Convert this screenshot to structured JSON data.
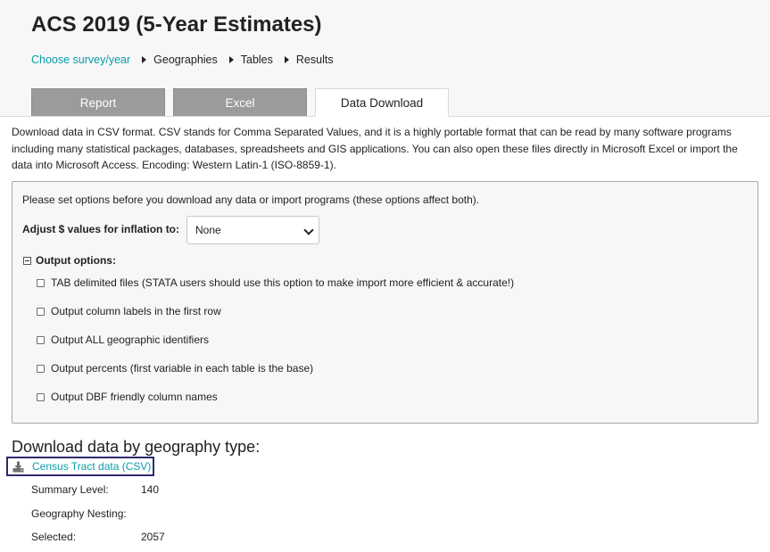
{
  "header": {
    "title": "ACS 2019 (5-Year Estimates)",
    "breadcrumbs": [
      "Choose survey/year",
      "Geographies",
      "Tables",
      "Results"
    ]
  },
  "tabs": [
    {
      "label": "Report",
      "active": false
    },
    {
      "label": "Excel",
      "active": false
    },
    {
      "label": "Data Download",
      "active": true
    }
  ],
  "intro_text": "Download data in CSV format. CSV stands for Comma Separated Values, and it is a highly portable format that can be read by many software programs including many statistical packages, databases, spreadsheets and GIS applications. You can also open these files directly in Microsoft Excel or import the data into Microsoft Access. Encoding: Western Latin-1 (ISO-8859-1).",
  "options": {
    "note": "Please set options before you download any data or import programs (these options affect both).",
    "inflation_label": "Adjust $ values for inflation to:",
    "inflation_value": "None",
    "output_options_label": "Output options:",
    "checkboxes": [
      {
        "label": "TAB delimited files (STATA users should use this option to make import more efficient & accurate!)",
        "checked": false
      },
      {
        "label": "Output column labels in the first row",
        "checked": false
      },
      {
        "label": "Output ALL geographic identifiers",
        "checked": false
      },
      {
        "label": "Output percents (first variable in each table is the base)",
        "checked": false
      },
      {
        "label": "Output DBF friendly column names",
        "checked": false
      }
    ]
  },
  "geography": {
    "heading": "Download data by geography type:",
    "link_label": "Census Tract data (CSV)",
    "icon": "download-icon",
    "summary_level_label": "Summary Level:",
    "summary_level_value": "140",
    "nesting_label": "Geography Nesting:",
    "selected_label": "Selected:",
    "selected_value": "2057"
  },
  "colors": {
    "link": "#0a9cab",
    "inactive_tab": "#9b9b9b",
    "focus_border": "#2e2a6e"
  }
}
